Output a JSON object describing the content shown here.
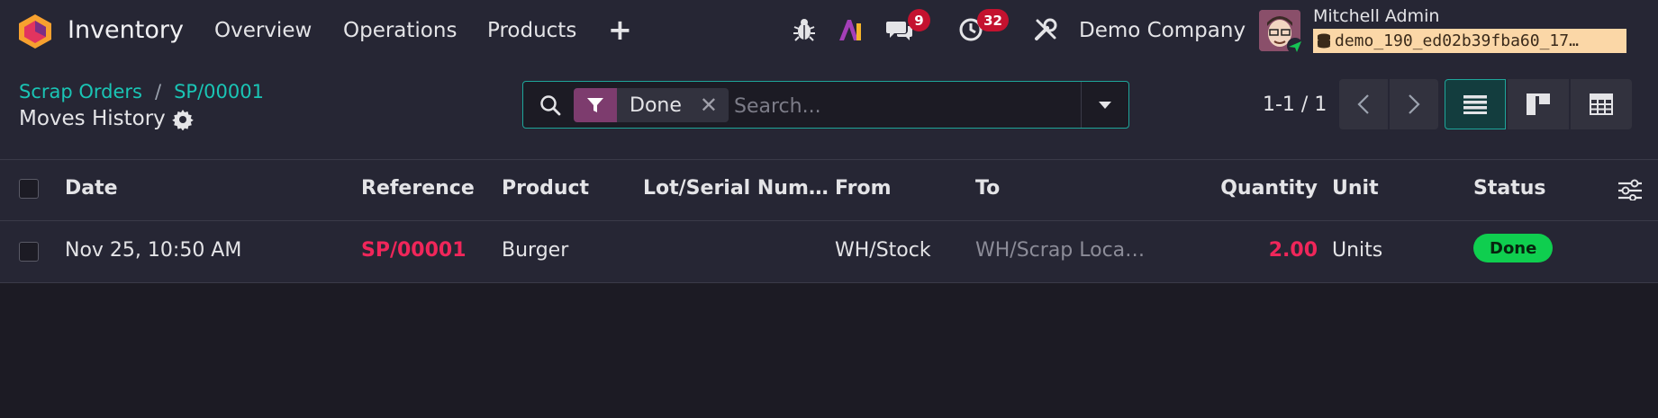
{
  "navbar": {
    "app_name": "Inventory",
    "menu": [
      "Overview",
      "Operations",
      "Products"
    ],
    "add_symbol": "+",
    "messages_count": "9",
    "activities_count": "32",
    "company": "Demo Company",
    "user_name": "Mitchell Admin",
    "database": "demo_190_ed02b39fba60_17…",
    "colors": {
      "navbar_bg": "#262634",
      "badge": "#c4122f",
      "db_tag": "#fbd7a7"
    }
  },
  "control": {
    "breadcrumb": [
      "Scrap Orders",
      "SP/00001"
    ],
    "breadcrumb_sep": "/",
    "title": "Moves History",
    "search": {
      "facet_value": "Done",
      "placeholder": "Search..."
    },
    "pager": "1-1 / 1",
    "views": [
      "list-view",
      "kanban-view",
      "pivot-view"
    ],
    "colors": {
      "accent": "#1ac5b5",
      "facet": "#7d3c6e"
    }
  },
  "table": {
    "columns": [
      "Date",
      "Reference",
      "Product",
      "Lot/Serial Num…",
      "From",
      "To",
      "Quantity",
      "Unit",
      "Status"
    ],
    "rows": [
      {
        "date": "Nov 25, 10:50 AM",
        "reference": "SP/00001",
        "product": "Burger",
        "lot": "",
        "from": "WH/Stock",
        "to": "WH/Scrap Loca…",
        "quantity": "2.00",
        "unit": "Units",
        "status": "Done"
      }
    ],
    "colors": {
      "reference": "#f0265a",
      "status_done": "#0fce4f"
    }
  }
}
